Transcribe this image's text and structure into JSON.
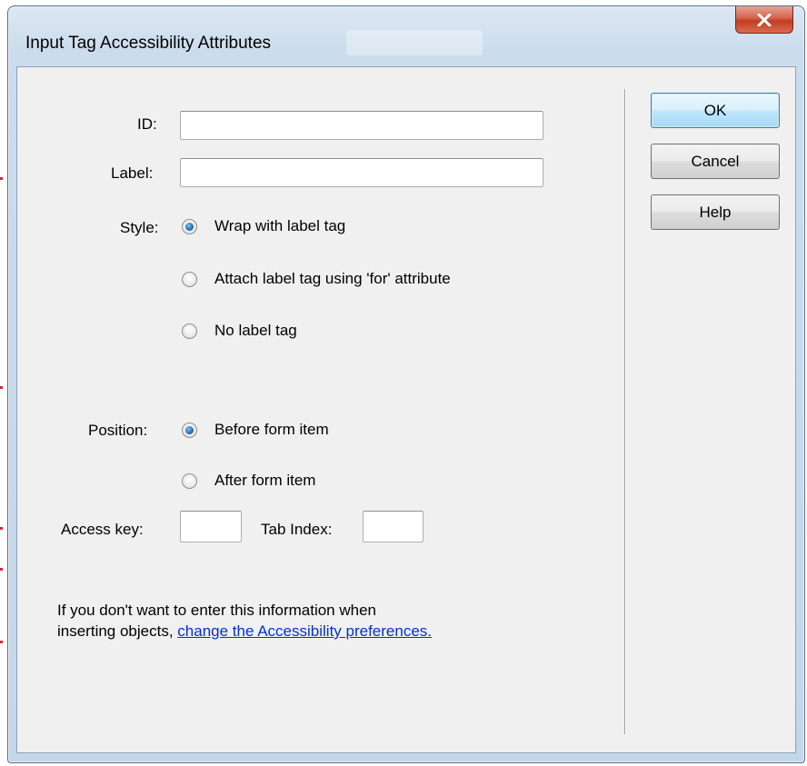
{
  "dialog": {
    "title": "Input Tag Accessibility Attributes",
    "close_label": "X"
  },
  "fields": {
    "id_label": "ID:",
    "id_value": "",
    "label_label": "Label:",
    "label_value": "",
    "access_key_label": "Access key:",
    "access_key_value": "",
    "tab_index_label": "Tab Index:",
    "tab_index_value": ""
  },
  "style": {
    "label": "Style:",
    "options": [
      {
        "label": "Wrap with label tag",
        "checked": true
      },
      {
        "label": "Attach label tag using 'for' attribute",
        "checked": false
      },
      {
        "label": "No label tag",
        "checked": false
      }
    ]
  },
  "position": {
    "label": "Position:",
    "options": [
      {
        "label": "Before form item",
        "checked": true
      },
      {
        "label": "After form item",
        "checked": false
      }
    ]
  },
  "buttons": {
    "ok": "OK",
    "cancel": "Cancel",
    "help": "Help"
  },
  "info": {
    "text_line1": "If you don't want to enter this information when",
    "text_line2": "inserting objects, ",
    "link": "change the Accessibility preferences."
  },
  "colors": {
    "link": "#0033cc",
    "close_button": "#c23d22",
    "radio_selected": "#2672b8"
  }
}
